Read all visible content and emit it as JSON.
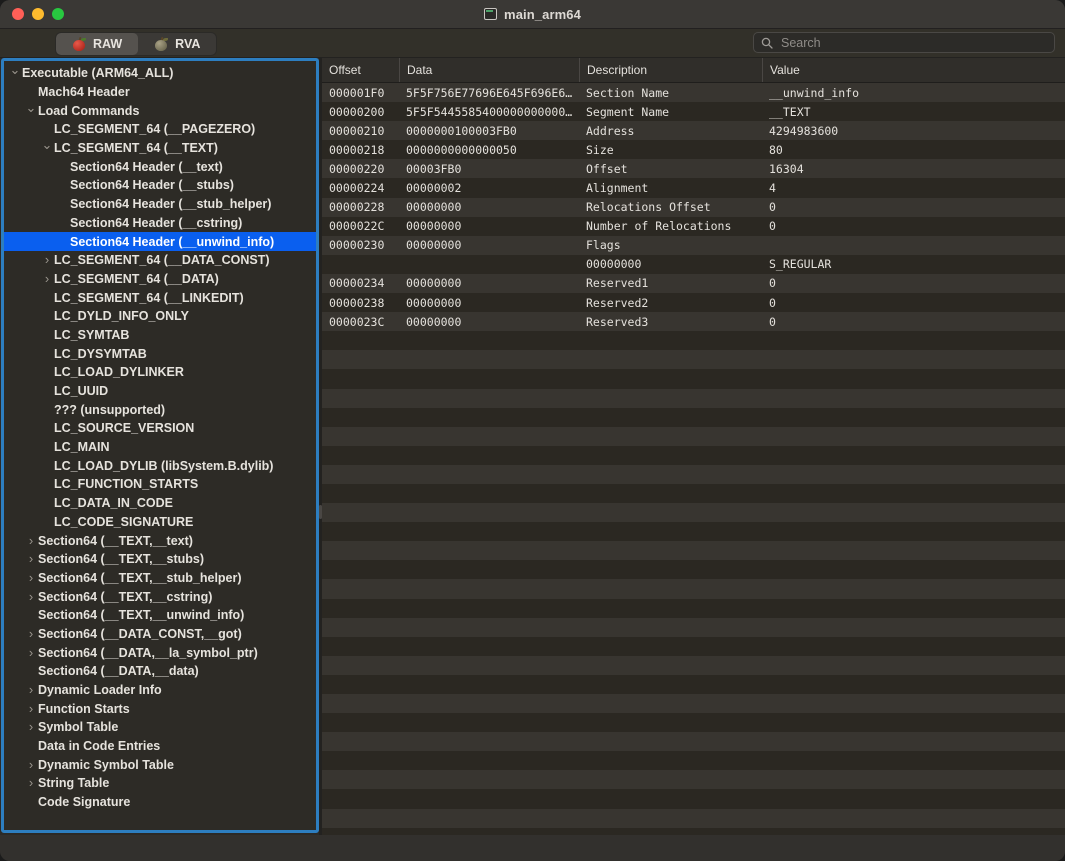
{
  "window": {
    "title": "main_arm64",
    "traffic_lights": [
      "close-button",
      "minimize-button",
      "maximize-button"
    ],
    "doc_icon": "document-icon"
  },
  "toolbar": {
    "tabs": [
      {
        "label": "RAW",
        "icon": "red-apple-icon",
        "selected": true
      },
      {
        "label": "RVA",
        "icon": "grey-apple-icon",
        "selected": false
      }
    ],
    "search": {
      "placeholder": "Search",
      "value": "",
      "icon": "search-icon"
    }
  },
  "colors": {
    "selection_blue": "#0a5fef",
    "focus_ring_blue": "#2d7ec0",
    "window_bg": "#32302d",
    "sidebar_bg": "#2d2b26",
    "row_odd": "#383530",
    "row_even": "#2b2822"
  },
  "sidebar": {
    "items": [
      {
        "label": "Executable  (ARM64_ALL)",
        "indent": 0,
        "chevron": "down",
        "selected": false
      },
      {
        "label": "Mach64 Header",
        "indent": 1,
        "chevron": "none",
        "selected": false
      },
      {
        "label": "Load Commands",
        "indent": 1,
        "chevron": "down",
        "selected": false
      },
      {
        "label": "LC_SEGMENT_64 (__PAGEZERO)",
        "indent": 2,
        "chevron": "none",
        "selected": false
      },
      {
        "label": "LC_SEGMENT_64 (__TEXT)",
        "indent": 2,
        "chevron": "down",
        "selected": false
      },
      {
        "label": "Section64 Header (__text)",
        "indent": 3,
        "chevron": "none",
        "selected": false
      },
      {
        "label": "Section64 Header (__stubs)",
        "indent": 3,
        "chevron": "none",
        "selected": false
      },
      {
        "label": "Section64 Header (__stub_helper)",
        "indent": 3,
        "chevron": "none",
        "selected": false
      },
      {
        "label": "Section64 Header (__cstring)",
        "indent": 3,
        "chevron": "none",
        "selected": false
      },
      {
        "label": "Section64 Header (__unwind_info)",
        "indent": 3,
        "chevron": "none",
        "selected": true
      },
      {
        "label": "LC_SEGMENT_64 (__DATA_CONST)",
        "indent": 2,
        "chevron": "right",
        "selected": false
      },
      {
        "label": "LC_SEGMENT_64 (__DATA)",
        "indent": 2,
        "chevron": "right",
        "selected": false
      },
      {
        "label": "LC_SEGMENT_64 (__LINKEDIT)",
        "indent": 2,
        "chevron": "none",
        "selected": false
      },
      {
        "label": "LC_DYLD_INFO_ONLY",
        "indent": 2,
        "chevron": "none",
        "selected": false
      },
      {
        "label": "LC_SYMTAB",
        "indent": 2,
        "chevron": "none",
        "selected": false
      },
      {
        "label": "LC_DYSYMTAB",
        "indent": 2,
        "chevron": "none",
        "selected": false
      },
      {
        "label": "LC_LOAD_DYLINKER",
        "indent": 2,
        "chevron": "none",
        "selected": false
      },
      {
        "label": "LC_UUID",
        "indent": 2,
        "chevron": "none",
        "selected": false
      },
      {
        "label": "??? (unsupported)",
        "indent": 2,
        "chevron": "none",
        "selected": false
      },
      {
        "label": "LC_SOURCE_VERSION",
        "indent": 2,
        "chevron": "none",
        "selected": false
      },
      {
        "label": "LC_MAIN",
        "indent": 2,
        "chevron": "none",
        "selected": false
      },
      {
        "label": "LC_LOAD_DYLIB (libSystem.B.dylib)",
        "indent": 2,
        "chevron": "none",
        "selected": false
      },
      {
        "label": "LC_FUNCTION_STARTS",
        "indent": 2,
        "chevron": "none",
        "selected": false
      },
      {
        "label": "LC_DATA_IN_CODE",
        "indent": 2,
        "chevron": "none",
        "selected": false
      },
      {
        "label": "LC_CODE_SIGNATURE",
        "indent": 2,
        "chevron": "none",
        "selected": false
      },
      {
        "label": "Section64 (__TEXT,__text)",
        "indent": 1,
        "chevron": "right",
        "selected": false
      },
      {
        "label": "Section64 (__TEXT,__stubs)",
        "indent": 1,
        "chevron": "right",
        "selected": false
      },
      {
        "label": "Section64 (__TEXT,__stub_helper)",
        "indent": 1,
        "chevron": "right",
        "selected": false
      },
      {
        "label": "Section64 (__TEXT,__cstring)",
        "indent": 1,
        "chevron": "right",
        "selected": false
      },
      {
        "label": "Section64 (__TEXT,__unwind_info)",
        "indent": 1,
        "chevron": "none",
        "selected": false
      },
      {
        "label": "Section64 (__DATA_CONST,__got)",
        "indent": 1,
        "chevron": "right",
        "selected": false
      },
      {
        "label": "Section64 (__DATA,__la_symbol_ptr)",
        "indent": 1,
        "chevron": "right",
        "selected": false
      },
      {
        "label": "Section64 (__DATA,__data)",
        "indent": 1,
        "chevron": "none",
        "selected": false
      },
      {
        "label": "Dynamic Loader Info",
        "indent": 1,
        "chevron": "right",
        "selected": false
      },
      {
        "label": "Function Starts",
        "indent": 1,
        "chevron": "right",
        "selected": false
      },
      {
        "label": "Symbol Table",
        "indent": 1,
        "chevron": "right",
        "selected": false
      },
      {
        "label": "Data in Code Entries",
        "indent": 1,
        "chevron": "none",
        "selected": false
      },
      {
        "label": "Dynamic Symbol Table",
        "indent": 1,
        "chevron": "right",
        "selected": false
      },
      {
        "label": "String Table",
        "indent": 1,
        "chevron": "right",
        "selected": false
      },
      {
        "label": "Code Signature",
        "indent": 1,
        "chevron": "none",
        "selected": false
      }
    ]
  },
  "table": {
    "columns": [
      "Offset",
      "Data",
      "Description",
      "Value"
    ],
    "rows": [
      [
        "000001F0",
        "5F5F756E77696E645F696E6…",
        "Section Name",
        "__unwind_info"
      ],
      [
        "00000200",
        "5F5F5445585400000000000…",
        "Segment Name",
        "__TEXT"
      ],
      [
        "00000210",
        "0000000100003FB0",
        "Address",
        "4294983600"
      ],
      [
        "00000218",
        "0000000000000050",
        "Size",
        "80"
      ],
      [
        "00000220",
        "00003FB0",
        "Offset",
        "16304"
      ],
      [
        "00000224",
        "00000002",
        "Alignment",
        "4"
      ],
      [
        "00000228",
        "00000000",
        "Relocations Offset",
        "0"
      ],
      [
        "0000022C",
        "00000000",
        "Number of Relocations",
        "0"
      ],
      [
        "00000230",
        "00000000",
        "Flags",
        ""
      ],
      [
        "",
        "",
        "00000000",
        "S_REGULAR"
      ],
      [
        "00000234",
        "00000000",
        "Reserved1",
        "0"
      ],
      [
        "00000238",
        "00000000",
        "Reserved2",
        "0"
      ],
      [
        "0000023C",
        "00000000",
        "Reserved3",
        "0"
      ]
    ],
    "empty_row_count": 27
  }
}
